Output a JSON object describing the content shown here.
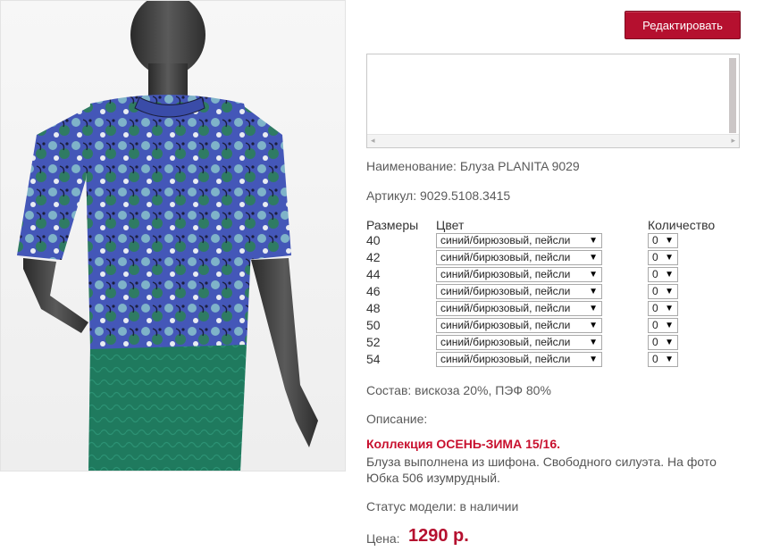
{
  "toolbar": {
    "edit_label": "Редактировать"
  },
  "product": {
    "name_label": "Наименование:",
    "name_value": "Блуза PLANITA 9029",
    "article_label": "Артикул:",
    "article_value": "9029.5108.3415",
    "composition_label": "Состав:",
    "composition_value": "вискоза 20%, ПЭФ 80%",
    "description_label": "Описание:",
    "collection": "Коллекция ОСЕНЬ-ЗИМА 15/16.",
    "description": "Блуза выполнена из шифона. Свободного силуэта. На фото Юбка 506 изумрудный.",
    "status_label": "Статус модели:",
    "status_value": "в наличии",
    "price_label": "Цена:",
    "price_value": "1290 р."
  },
  "table": {
    "headers": {
      "size": "Размеры",
      "color": "Цвет",
      "quantity": "Количество"
    },
    "rows": [
      {
        "size": "40",
        "color": "синий/бирюзовый, пейсли",
        "qty": "0"
      },
      {
        "size": "42",
        "color": "синий/бирюзовый, пейсли",
        "qty": "0"
      },
      {
        "size": "44",
        "color": "синий/бирюзовый, пейсли",
        "qty": "0"
      },
      {
        "size": "46",
        "color": "синий/бирюзовый, пейсли",
        "qty": "0"
      },
      {
        "size": "48",
        "color": "синий/бирюзовый, пейсли",
        "qty": "0"
      },
      {
        "size": "50",
        "color": "синий/бирюзовый, пейсли",
        "qty": "0"
      },
      {
        "size": "52",
        "color": "синий/бирюзовый, пейсли",
        "qty": "0"
      },
      {
        "size": "54",
        "color": "синий/бирюзовый, пейсли",
        "qty": "0"
      }
    ]
  },
  "colors": {
    "accent": "#b5102f",
    "collection": "#c8102e",
    "skirt": "#1f7a5e",
    "blouse": "#3e56b0"
  }
}
